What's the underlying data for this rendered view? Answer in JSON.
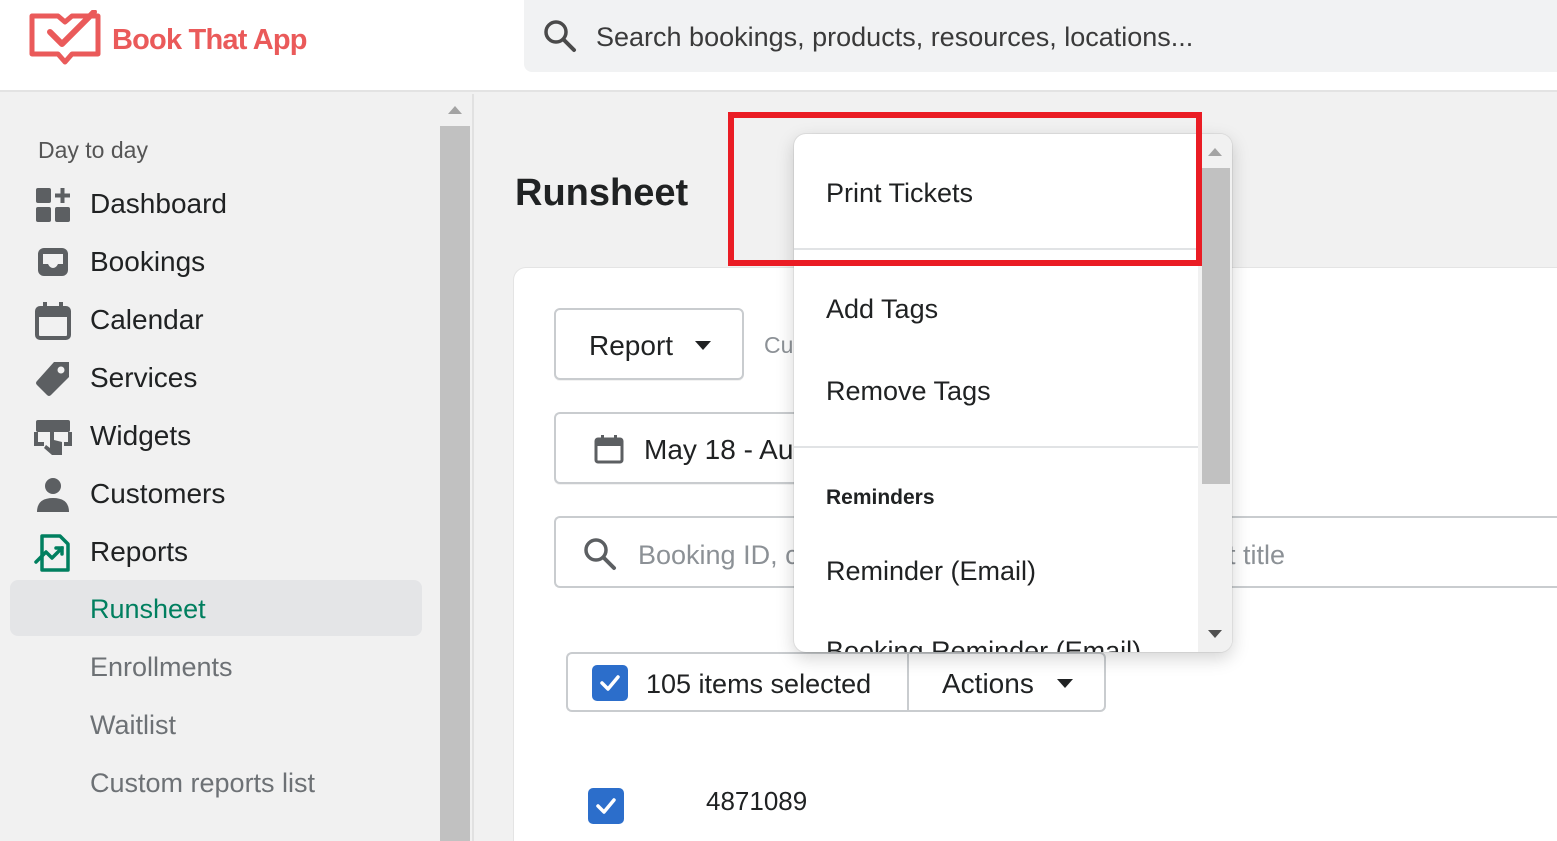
{
  "app": {
    "name": "Book That App",
    "brand_color": "#ea5a5a"
  },
  "search": {
    "placeholder": "Search bookings, products, resources, locations..."
  },
  "sidebar": {
    "section_title": "Day to day",
    "items": [
      {
        "label": "Dashboard",
        "icon": "dashboard-icon"
      },
      {
        "label": "Bookings",
        "icon": "inbox-icon"
      },
      {
        "label": "Calendar",
        "icon": "calendar-icon"
      },
      {
        "label": "Services",
        "icon": "tag-icon"
      },
      {
        "label": "Widgets",
        "icon": "widget-icon"
      },
      {
        "label": "Customers",
        "icon": "person-icon"
      },
      {
        "label": "Reports",
        "icon": "reports-icon"
      }
    ],
    "sub_items": [
      {
        "label": "Runsheet",
        "active": true
      },
      {
        "label": "Enrollments",
        "active": false
      },
      {
        "label": "Waitlist",
        "active": false
      },
      {
        "label": "Custom reports list",
        "active": false
      }
    ],
    "active_color": "#007f5f"
  },
  "main": {
    "title": "Runsheet",
    "report_button": "Report",
    "cu_text": "Cu",
    "date_range": "May 18 - Au",
    "booking_search": {
      "placeholder": "Booking ID, c",
      "placeholder_tail": "t title"
    },
    "bulk": {
      "selected_label": "105 items selected",
      "actions_label": "Actions"
    },
    "first_row_id": "4871089"
  },
  "dropdown": {
    "items": {
      "print_tickets": "Print Tickets",
      "add_tags": "Add Tags",
      "remove_tags": "Remove Tags",
      "reminders_heading": "Reminders",
      "reminder_email": "Reminder (Email)",
      "booking_reminder_email": "Booking Reminder (Email)"
    },
    "highlight_color": "#ea1c24"
  },
  "colors": {
    "checkbox": "#2c6ecb"
  }
}
